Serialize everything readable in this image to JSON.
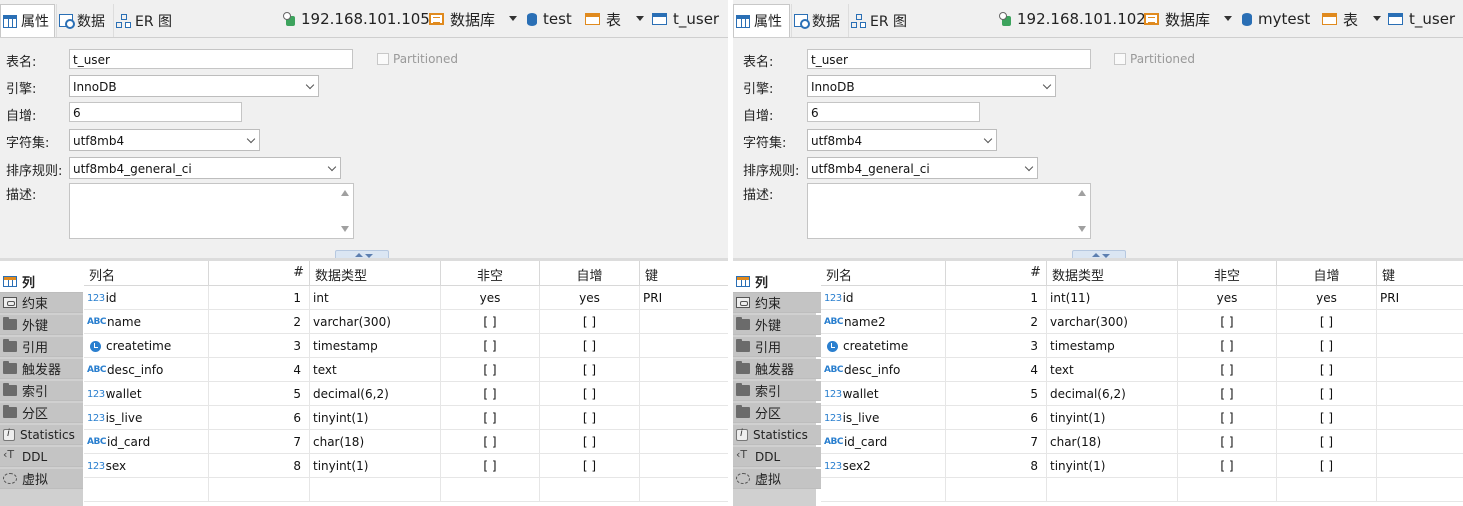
{
  "panes": [
    {
      "tabs": {
        "properties": "属性",
        "data": "数据",
        "er": "ER 图"
      },
      "crumbs": {
        "host": "192.168.101.105",
        "db_folder": "数据库",
        "database": "test",
        "table_folder": "表",
        "table": "t_user"
      },
      "form": {
        "name_label": "表名:",
        "name_value": "t_user",
        "partitioned_label": "Partitioned",
        "engine_label": "引擎:",
        "engine_value": "InnoDB",
        "autoinc_label": "自增:",
        "autoinc_value": "6",
        "charset_label": "字符集:",
        "charset_value": "utf8mb4",
        "collation_label": "排序规则:",
        "collation_value": "utf8mb4_general_ci",
        "desc_label": "描述:",
        "desc_value": ""
      },
      "sidetabs": [
        "列",
        "约束",
        "外键",
        "引用",
        "触发器",
        "索引",
        "分区",
        "Statistics",
        "DDL",
        "虚拟"
      ],
      "columns_header": {
        "name": "列名",
        "num": "#",
        "type": "数据类型",
        "notnull": "非空",
        "autoinc": "自增",
        "key": "键"
      },
      "rows": [
        {
          "icon": "123k",
          "name": "id",
          "num": "1",
          "type": "int",
          "notnull": "yes",
          "autoinc": "yes",
          "key": "PRI"
        },
        {
          "icon": "abc",
          "name": "name",
          "num": "2",
          "type": "varchar(300)",
          "notnull": "[ ]",
          "autoinc": "[ ]",
          "key": ""
        },
        {
          "icon": "clock",
          "name": "createtime",
          "num": "3",
          "type": "timestamp",
          "notnull": "[ ]",
          "autoinc": "[ ]",
          "key": ""
        },
        {
          "icon": "abc",
          "name": "desc_info",
          "num": "4",
          "type": "text",
          "notnull": "[ ]",
          "autoinc": "[ ]",
          "key": ""
        },
        {
          "icon": "123",
          "name": "wallet",
          "num": "5",
          "type": "decimal(6,2)",
          "notnull": "[ ]",
          "autoinc": "[ ]",
          "key": ""
        },
        {
          "icon": "123",
          "name": "is_live",
          "num": "6",
          "type": "tinyint(1)",
          "notnull": "[ ]",
          "autoinc": "[ ]",
          "key": ""
        },
        {
          "icon": "abc",
          "name": "id_card",
          "num": "7",
          "type": "char(18)",
          "notnull": "[ ]",
          "autoinc": "[ ]",
          "key": ""
        },
        {
          "icon": "123",
          "name": "sex",
          "num": "8",
          "type": "tinyint(1)",
          "notnull": "[ ]",
          "autoinc": "[ ]",
          "key": ""
        }
      ]
    },
    {
      "tabs": {
        "properties": "属性",
        "data": "数据",
        "er": "ER 图"
      },
      "crumbs": {
        "host": "192.168.101.102",
        "db_folder": "数据库",
        "database": "mytest",
        "table_folder": "表",
        "table": "t_user"
      },
      "form": {
        "name_label": "表名:",
        "name_value": "t_user",
        "partitioned_label": "Partitioned",
        "engine_label": "引擎:",
        "engine_value": "InnoDB",
        "autoinc_label": "自增:",
        "autoinc_value": "6",
        "charset_label": "字符集:",
        "charset_value": "utf8mb4",
        "collation_label": "排序规则:",
        "collation_value": "utf8mb4_general_ci",
        "desc_label": "描述:",
        "desc_value": ""
      },
      "sidetabs": [
        "列",
        "约束",
        "外键",
        "引用",
        "触发器",
        "索引",
        "分区",
        "Statistics",
        "DDL",
        "虚拟"
      ],
      "columns_header": {
        "name": "列名",
        "num": "#",
        "type": "数据类型",
        "notnull": "非空",
        "autoinc": "自增",
        "key": "键"
      },
      "rows": [
        {
          "icon": "123k",
          "name": "id",
          "num": "1",
          "type": "int(11)",
          "notnull": "yes",
          "autoinc": "yes",
          "key": "PRI"
        },
        {
          "icon": "abc",
          "name": "name2",
          "num": "2",
          "type": "varchar(300)",
          "notnull": "[ ]",
          "autoinc": "[ ]",
          "key": ""
        },
        {
          "icon": "clock",
          "name": "createtime",
          "num": "3",
          "type": "timestamp",
          "notnull": "[ ]",
          "autoinc": "[ ]",
          "key": ""
        },
        {
          "icon": "abc",
          "name": "desc_info",
          "num": "4",
          "type": "text",
          "notnull": "[ ]",
          "autoinc": "[ ]",
          "key": ""
        },
        {
          "icon": "123",
          "name": "wallet",
          "num": "5",
          "type": "decimal(6,2)",
          "notnull": "[ ]",
          "autoinc": "[ ]",
          "key": ""
        },
        {
          "icon": "123",
          "name": "is_live",
          "num": "6",
          "type": "tinyint(1)",
          "notnull": "[ ]",
          "autoinc": "[ ]",
          "key": ""
        },
        {
          "icon": "abc",
          "name": "id_card",
          "num": "7",
          "type": "char(18)",
          "notnull": "[ ]",
          "autoinc": "[ ]",
          "key": ""
        },
        {
          "icon": "123",
          "name": "sex2",
          "num": "8",
          "type": "tinyint(1)",
          "notnull": "[ ]",
          "autoinc": "[ ]",
          "key": ""
        }
      ]
    }
  ]
}
